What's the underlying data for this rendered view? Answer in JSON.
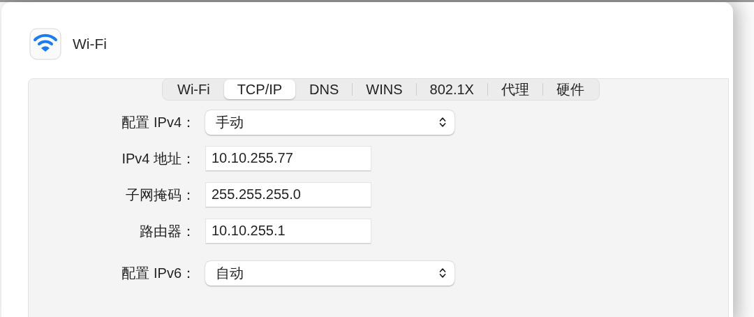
{
  "window": {
    "title": "Wi-Fi"
  },
  "tabs": [
    {
      "label": "Wi-Fi",
      "selected": false
    },
    {
      "label": "TCP/IP",
      "selected": true
    },
    {
      "label": "DNS",
      "selected": false
    },
    {
      "label": "WINS",
      "selected": false
    },
    {
      "label": "802.1X",
      "selected": false
    },
    {
      "label": "代理",
      "selected": false
    },
    {
      "label": "硬件",
      "selected": false
    }
  ],
  "form": {
    "groups": [
      [
        {
          "kind": "popup",
          "label": "配置 IPv4：",
          "value": "手动"
        },
        {
          "kind": "text",
          "label": "IPv4 地址：",
          "value": "10.10.255.77"
        },
        {
          "kind": "text",
          "label": "子网掩码：",
          "value": "255.255.255.0"
        },
        {
          "kind": "text",
          "label": "路由器：",
          "value": "10.10.255.1"
        }
      ],
      [
        {
          "kind": "popup",
          "label": "配置 IPv6：",
          "value": "自动"
        }
      ]
    ]
  }
}
